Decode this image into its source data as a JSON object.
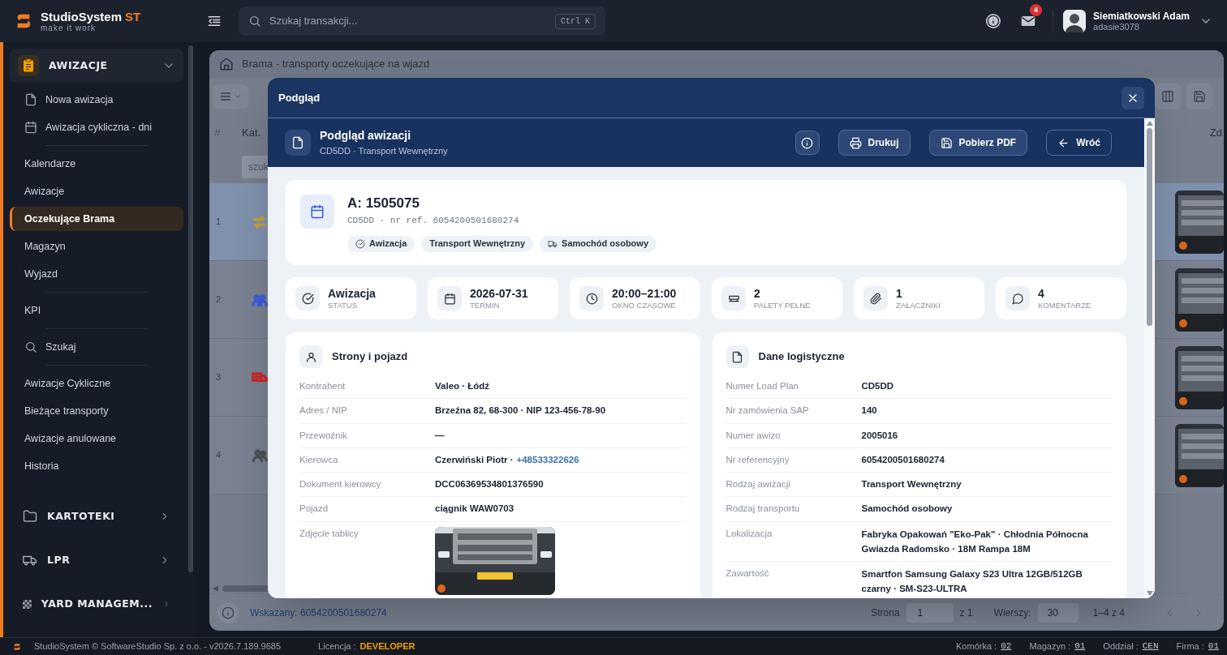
{
  "app": {
    "name": "StudioSystem",
    "name_accent": "ST",
    "tagline": "make it work"
  },
  "search": {
    "placeholder": "Szukaj transakcji...",
    "shortcut": "Ctrl K"
  },
  "notifications": {
    "count": "4"
  },
  "user": {
    "name": "Siemiatkowski Adam",
    "login": "adasie3078"
  },
  "sidebar": {
    "sections": [
      {
        "label": "AWIZACJE",
        "kind": "clipboard",
        "expanded": true,
        "groups": [
          [
            {
              "label": "Nowa awizacja",
              "kind": "document",
              "selected": false
            },
            {
              "label": "Awizacja cykliczna - dni",
              "kind": "calendar",
              "selected": false
            }
          ],
          [
            {
              "label": "Kalendarze",
              "kind": "plain",
              "selected": false
            },
            {
              "label": "Awizacje",
              "kind": "plain",
              "selected": false
            },
            {
              "label": "Oczekujące Brama",
              "kind": "plain",
              "selected": true
            },
            {
              "label": "Magazyn",
              "kind": "plain",
              "selected": false
            },
            {
              "label": "Wyjazd",
              "kind": "plain",
              "selected": false
            }
          ],
          [
            {
              "label": "KPI",
              "kind": "plain",
              "selected": false
            }
          ],
          [
            {
              "label": "Szukaj",
              "kind": "search",
              "selected": false
            }
          ],
          [
            {
              "label": "Awizacje Cykliczne",
              "kind": "plain",
              "selected": false
            },
            {
              "label": "Bieżące transporty",
              "kind": "plain",
              "selected": false
            },
            {
              "label": "Awizacje anulowane",
              "kind": "plain",
              "selected": false
            },
            {
              "label": "Historia",
              "kind": "plain",
              "selected": false
            }
          ]
        ]
      },
      {
        "label": "KARTOTEKI",
        "kind": "folder",
        "expanded": false
      },
      {
        "label": "LPR",
        "kind": "truck",
        "expanded": false
      },
      {
        "label": "YARD MANAGEM...",
        "kind": "grid",
        "expanded": false
      }
    ]
  },
  "page": {
    "title": "Brama - transporty oczekujące na wjazd",
    "table": {
      "columns": [
        "#",
        "Kat.",
        "Zd"
      ],
      "filter_placeholder": "szuk",
      "rows": [
        {
          "number": "1",
          "kind": "transfer",
          "color": "#c9a227",
          "selected": true
        },
        {
          "number": "2",
          "kind": "group",
          "color": "#3b5bdb",
          "selected": false
        },
        {
          "number": "3",
          "kind": "ambulance",
          "color": "#c92a2a",
          "selected": false
        },
        {
          "number": "4",
          "kind": "people",
          "color": "#495057",
          "selected": false
        }
      ]
    },
    "footer": {
      "selected": "Wskazany: 6054200501680274",
      "page_label": "Strona",
      "page": "1",
      "page_total": "z 1",
      "rows_label": "Wierszy:",
      "rows": "30",
      "range": "1–4 z 4"
    }
  },
  "modal": {
    "title": "Podgląd",
    "header": {
      "title": "Podgląd awizacji",
      "subtitle": "CD5DD · Transport Wewnętrzny"
    },
    "buttons": [
      {
        "kind": "info"
      },
      {
        "label": "Drukuj",
        "kind": "print"
      },
      {
        "label": "Pobierz PDF",
        "kind": "save"
      },
      {
        "label": "Wróć",
        "kind": "back"
      }
    ],
    "summary": {
      "title": "A: 1505075",
      "subtitle": "CD5DD · nr ref. 6054200501680274",
      "tags": [
        {
          "label": "Awizacja",
          "kind": "check"
        },
        {
          "label": "Transport Wewnętrzny",
          "kind": "plain"
        },
        {
          "label": "Samochód osobowy",
          "kind": "truck"
        }
      ]
    },
    "stats": [
      {
        "value": "Awizacja",
        "label": "STATUS",
        "kind": "check"
      },
      {
        "value": "2026-07-31",
        "label": "TERMIN",
        "kind": "calendar"
      },
      {
        "value": "20:00–21:00",
        "label": "OKNO CZASOWE",
        "kind": "clock"
      },
      {
        "value": "2",
        "label": "PALETY PEŁNE",
        "kind": "pallet"
      },
      {
        "value": "1",
        "label": "ZAŁĄCZNIKI",
        "kind": "clip"
      },
      {
        "value": "4",
        "label": "KOMENTARZE",
        "kind": "comment"
      }
    ],
    "panels": [
      {
        "title": "Strony i pojazd",
        "kind": "user",
        "rows": [
          {
            "label": "Kontrahent",
            "value": "Valeo · Łódź"
          },
          {
            "label": "Adres / NIP",
            "value": "Brzeźna 82, 68-300 · NIP 123-456-78-90"
          },
          {
            "label": "Przewoźnik",
            "value": "—"
          },
          {
            "label": "Kierowca",
            "value": "Czerwiński Piotr ·",
            "link": "+48533322626"
          },
          {
            "label": "Dokument kierowcy",
            "value": "DCC06369534801376590"
          },
          {
            "label": "Pojazd",
            "value": "ciągnik WAW0703"
          },
          {
            "label": "Zdjęcie tablicy",
            "kind": "picture"
          }
        ]
      },
      {
        "title": "Dane logistyczne",
        "kind": "document",
        "rows": [
          {
            "label": "Numer Load Plan",
            "value": "CD5DD"
          },
          {
            "label": "Nr zamówienia SAP",
            "value": "140"
          },
          {
            "label": "Numer awizo",
            "value": "2005016"
          },
          {
            "label": "Nr referencyjny",
            "value": "6054200501680274"
          },
          {
            "label": "Rodzaj awizacji",
            "value": "Transport Wewnętrzny"
          },
          {
            "label": "Rodzaj transportu",
            "value": "Samochód osobowy"
          },
          {
            "label": "Lokalizacja",
            "value": "Fabryka Opakowań \"Eko-Pak\" · Chłodnia Północna Gwiazda Radomsko · 18M Rampa 18M"
          },
          {
            "label": "Zawartość",
            "value": "Smartfon Samsung Galaxy S23 Ultra 12GB/512GB czarny · SM-S23-ULTRA"
          }
        ]
      }
    ]
  },
  "status_bar": {
    "copyright": "StudioSystem © SoftwareStudio Sp. z o.o. - v2026.7.189.9685",
    "license_label": "Licencja :",
    "license": "DEVELOPER",
    "fields": [
      {
        "label": "Komórka :",
        "value": "02"
      },
      {
        "label": "Magazyn :",
        "value": "01"
      },
      {
        "label": "Oddział :",
        "value": "CEN"
      },
      {
        "label": "Firma :",
        "value": "01"
      }
    ]
  }
}
